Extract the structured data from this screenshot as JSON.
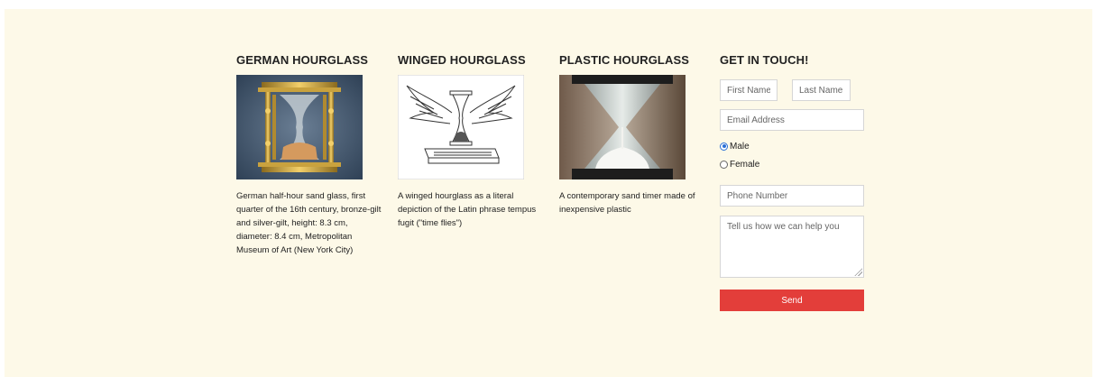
{
  "products": [
    {
      "title": "GERMAN HOURGLASS",
      "caption": "German half-hour sand glass, first quarter of the 16th century, bronze-gilt and silver-gilt, height: 8.3 cm, diameter: 8.4 cm, Metropolitan Museum of Art (New York City)"
    },
    {
      "title": "WINGED HOURGLASS",
      "caption": "A winged hourglass as a literal depiction of the Latin phrase tempus fugit (\"time flies\")"
    },
    {
      "title": "PLASTIC HOURGLASS",
      "caption": "A contemporary sand timer made of inexpensive plastic"
    }
  ],
  "contact": {
    "title": "GET IN TOUCH!",
    "first_name_placeholder": "First Name",
    "last_name_placeholder": "Last Name",
    "email_placeholder": "Email Address",
    "gender_options": [
      {
        "label": "Male",
        "checked": true
      },
      {
        "label": "Female",
        "checked": false
      }
    ],
    "phone_placeholder": "Phone Number",
    "message_placeholder": "Tell us how we can help you",
    "send_label": "Send"
  },
  "colors": {
    "page_background": "#fdf9e8",
    "send_button": "#e33e3a",
    "radio_accent": "#2a6fd6"
  }
}
